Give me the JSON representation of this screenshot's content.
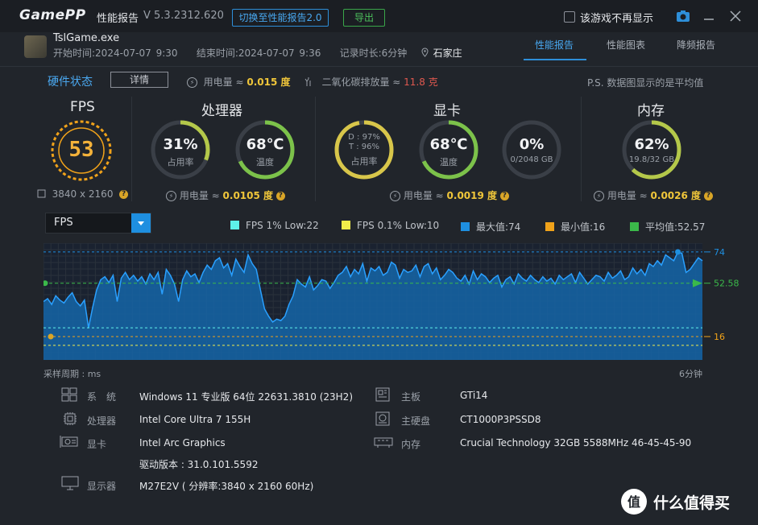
{
  "titlebar": {
    "logo_a": "Game",
    "logo_b": "PP",
    "title": "性能报告",
    "version": "V 5.3.2312.620",
    "switch_btn": "切换至性能报告2.0",
    "export_btn": "导出",
    "hide_game_label": "该游戏不再显示"
  },
  "session": {
    "exe": "TslGame.exe",
    "start_label": "开始时间:",
    "start": "2024-07-07 9:30",
    "end_label": "结束时间:",
    "end": "2024-07-07 9:36",
    "duration_label": "记录时长:",
    "duration": "6分钟",
    "location": "石家庄"
  },
  "tabs": [
    "性能报告",
    "性能图表",
    "降频报告"
  ],
  "hw_state": {
    "label": "硬件状态",
    "detail_btn": "详情",
    "power_label": "用电量 ≈",
    "power_value": "0.015 度",
    "co2_label": "二氧化碳排放量 ≈",
    "co2_value": "11.8 克",
    "note": "P.S. 数据图显示的是平均值"
  },
  "sections": {
    "fps": {
      "title": "FPS",
      "value": "53",
      "resolution": "3840 x 2160"
    },
    "cpu": {
      "title": "处理器",
      "usage": "31%",
      "usage_label": "占用率",
      "usage_frac": 0.31,
      "temp": "68℃",
      "temp_label": "温度",
      "temp_frac": 0.68,
      "power_label": "用电量 ≈",
      "power_value": "0.0105 度"
    },
    "gpu": {
      "title": "显卡",
      "d": "D : 97%",
      "t": "T : 96%",
      "usage_label": "占用率",
      "usage_frac": 0.97,
      "temp": "68℃",
      "temp_label": "温度",
      "temp_frac": 0.68,
      "vram": "0%",
      "vram_sub": "0/2048 GB",
      "vram_frac": 0,
      "power_label": "用电量 ≈",
      "power_value": "0.0019 度"
    },
    "mem": {
      "title": "内存",
      "usage": "62%",
      "sub": "19.8/32 GB",
      "usage_frac": 0.62,
      "power_label": "用电量 ≈",
      "power_value": "0.0026 度"
    }
  },
  "chart_selector": "FPS",
  "legend": [
    {
      "label": "FPS 1% Low:22",
      "color": "#5ef0ea"
    },
    {
      "label": "FPS 0.1% Low:10",
      "color": "#f2ee4a"
    },
    {
      "label": "最大值:74",
      "color": "#1e8fe0"
    },
    {
      "label": "最小值:16",
      "color": "#f0a21a"
    },
    {
      "label": "平均值:52.57",
      "color": "#3bb94a"
    }
  ],
  "chart_data": {
    "type": "area",
    "title": "FPS",
    "series": [
      {
        "name": "FPS",
        "values": [
          40,
          42,
          38,
          44,
          41,
          39,
          43,
          46,
          40,
          37,
          41,
          22,
          36,
          48,
          55,
          57,
          53,
          58,
          40,
          56,
          60,
          55,
          58,
          54,
          57,
          52,
          59,
          55,
          60,
          45,
          62,
          58,
          52,
          40,
          55,
          61,
          57,
          59,
          53,
          60,
          65,
          62,
          68,
          70,
          63,
          66,
          58,
          69,
          64,
          60,
          72,
          66,
          62,
          48,
          35,
          30,
          26,
          28,
          27,
          30,
          38,
          44,
          55,
          52,
          50,
          57,
          48,
          51,
          55,
          54,
          49,
          53,
          58,
          60,
          64,
          57,
          62,
          59,
          66,
          54,
          63,
          61,
          64,
          58,
          60,
          67,
          65,
          56,
          62,
          60,
          61,
          65,
          57,
          64,
          66,
          59,
          63,
          55,
          58,
          62,
          60,
          56,
          54,
          58,
          52,
          61,
          55,
          59,
          57,
          53,
          56,
          58,
          50,
          55,
          57,
          52,
          59,
          56,
          54,
          58,
          55,
          53,
          57,
          54,
          56,
          52,
          58,
          55,
          57,
          59,
          53,
          60,
          56,
          52,
          55,
          58,
          57,
          54,
          60,
          56,
          58,
          61,
          55,
          57,
          63,
          59,
          62,
          58,
          66,
          64,
          68,
          65,
          72,
          70,
          68,
          74,
          73,
          60,
          62,
          66,
          70,
          68
        ]
      },
      {
        "name": "FPS 1% Low",
        "values": [
          22
        ]
      },
      {
        "name": "FPS 0.1% Low",
        "values": [
          10
        ]
      }
    ],
    "max": 74,
    "min": 16,
    "avg": 52.58,
    "ylim": [
      0,
      80
    ],
    "xlabel_left": "采样周期 : ms",
    "xlabel_right": "6分钟",
    "ticks": [
      "74",
      "52.58",
      "16"
    ]
  },
  "system": {
    "rows": [
      {
        "icon": "windows-icon",
        "label": "系　统",
        "value": "Windows 11 专业版 64位 22631.3810 (23H2)"
      },
      {
        "icon": "cpu-icon",
        "label": "处理器",
        "value": "Intel Core Ultra 7 155H"
      },
      {
        "icon": "gpu-icon",
        "label": "显卡",
        "value": "Intel Arc Graphics",
        "extra": "驱动版本 : 31.0.101.5592"
      },
      {
        "icon": "monitor-icon",
        "label": "显示器",
        "value": "M27E2V ( 分辨率:3840 x 2160 60Hz)"
      }
    ],
    "rows_right": [
      {
        "icon": "board-icon",
        "label": "主板",
        "value": "GTi14"
      },
      {
        "icon": "disk-icon",
        "label": "主硬盘",
        "value": "CT1000P3PSSD8"
      },
      {
        "icon": "ram-icon",
        "label": "内存",
        "value": "Crucial Technology 32GB 5588MHz 46-45-45-90"
      }
    ]
  },
  "watermark": "什么值得买"
}
